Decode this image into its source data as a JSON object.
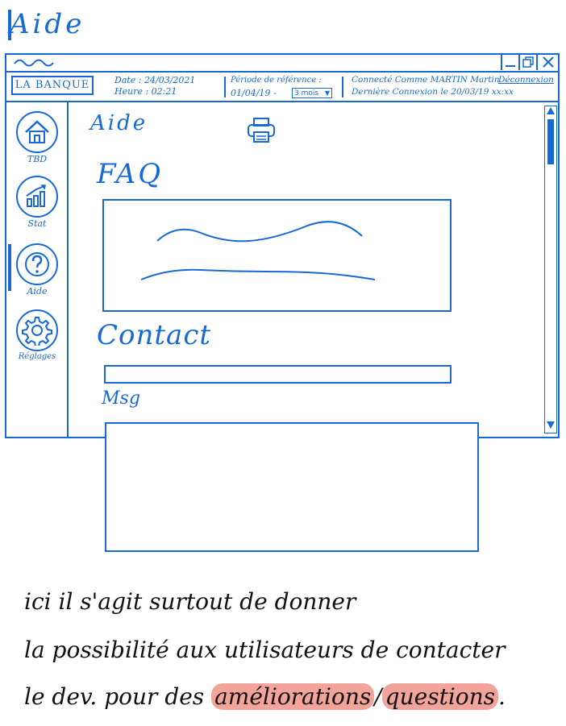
{
  "page": {
    "title": "Aide"
  },
  "header": {
    "logo": "LA BANQUE",
    "date": "Date : 24/03/2021",
    "time": "Heure : 02:21",
    "period_label": "Période de référence :",
    "period_start": "01/04/19 -",
    "period_select": "3 mois",
    "connected": "Connecté Comme MARTIN Martin",
    "logout": "Déconnexion",
    "last_connection": "Dernière Connexion le 20/03/19 xx:xx"
  },
  "sidebar": {
    "items": [
      {
        "label": "TBD",
        "icon": "home-icon"
      },
      {
        "label": "Stat",
        "icon": "chart-icon"
      },
      {
        "label": "Aide",
        "icon": "help-icon"
      },
      {
        "label": "Réglages",
        "icon": "gear-icon"
      }
    ],
    "active": "Aide"
  },
  "main": {
    "heading": "Aide",
    "faq_title": "FAQ",
    "contact_title": "Contact",
    "message_title": "Msg"
  },
  "note": {
    "line1": "ici il s'agit surtout de donner",
    "line2": "la possibilité aux utilisateurs de contacter",
    "line3_prefix": "le dev. pour des",
    "line3_hl1": "améliorations",
    "line3_sep": "/",
    "line3_hl2": "questions",
    "line3_suffix": ".",
    "highlight_color": "#f2a49a"
  },
  "colors": {
    "accent": "#1769d6",
    "ink": "#111111"
  }
}
